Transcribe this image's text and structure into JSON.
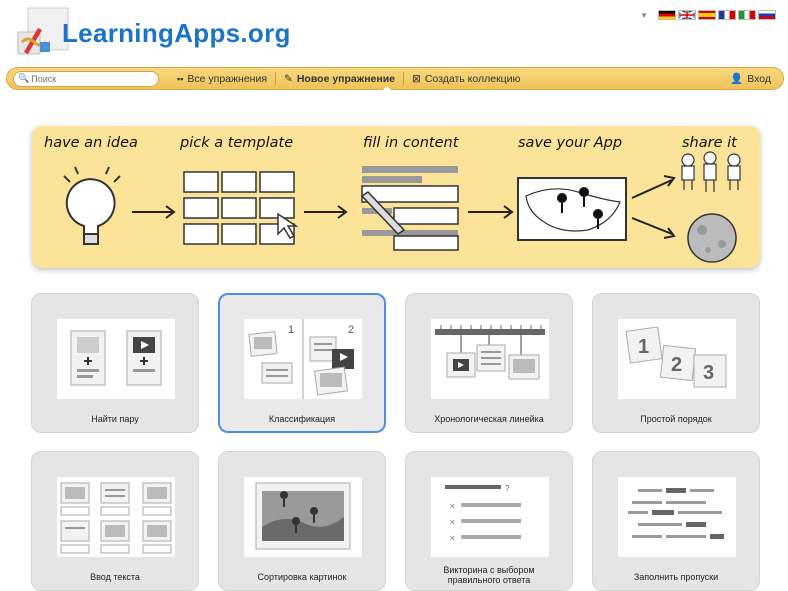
{
  "header": {
    "logo_text": "LearningApps.org",
    "colors": {
      "logo": "#1a74c9",
      "nav_bg": "#f3cc6a",
      "banner_bg": "#fbe39a",
      "card_bg": "#e5e5e5",
      "selected_border": "#4a90e2"
    }
  },
  "languages": [
    "de",
    "en",
    "es",
    "fr",
    "it",
    "ru"
  ],
  "nav": {
    "search_placeholder": "Поиск",
    "all_exercises": "Все упражнения",
    "new_exercise": "Новое упражнение",
    "create_collection": "Создать коллекцию",
    "login": "Вход"
  },
  "banner": {
    "steps": [
      "have an idea",
      "pick a template",
      "fill in content",
      "save your App",
      "share it"
    ]
  },
  "templates": [
    {
      "label": "Найти пару",
      "icon": "pairs-thumbnail"
    },
    {
      "label": "Классификация",
      "icon": "classification-thumbnail",
      "selected": true
    },
    {
      "label": "Хронологическая линейка",
      "icon": "timeline-thumbnail"
    },
    {
      "label": "Простой порядок",
      "icon": "simple-order-thumbnail"
    },
    {
      "label": "Ввод текста",
      "icon": "text-input-thumbnail"
    },
    {
      "label": "Сортировка картинок",
      "icon": "image-sort-thumbnail"
    },
    {
      "label_line1": "Викторина с выбором",
      "label_line2": "правильного ответа",
      "icon": "quiz-thumbnail"
    },
    {
      "label": "Заполнить пропуски",
      "icon": "fill-gaps-thumbnail"
    }
  ]
}
